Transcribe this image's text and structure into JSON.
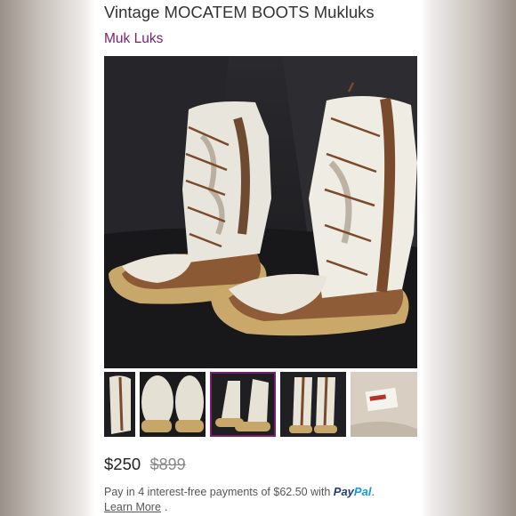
{
  "listing": {
    "title": "Vintage MOCATEM BOOTS Mukluks",
    "brand": "Muk Luks"
  },
  "gallery": {
    "main_image": "white fur mukluk boots with leather laces",
    "selected_index": 2,
    "thumbnails": [
      "thumbnail-boot-side",
      "thumbnail-boots-pair-top",
      "thumbnail-boots-pair",
      "thumbnail-boots-front",
      "thumbnail-label"
    ]
  },
  "pricing": {
    "price": "$250",
    "original_price": "$899",
    "installment_text": "Pay in 4 interest-free payments of $62.50 with ",
    "paypal_pay": "Pay",
    "paypal_pal": "Pal",
    "period": ".",
    "learn_more": "Learn More",
    "learn_more_period": "."
  },
  "colors": {
    "brand_link": "#7a1f6e",
    "paypal_dark": "#253b80",
    "paypal_light": "#179bd7"
  }
}
